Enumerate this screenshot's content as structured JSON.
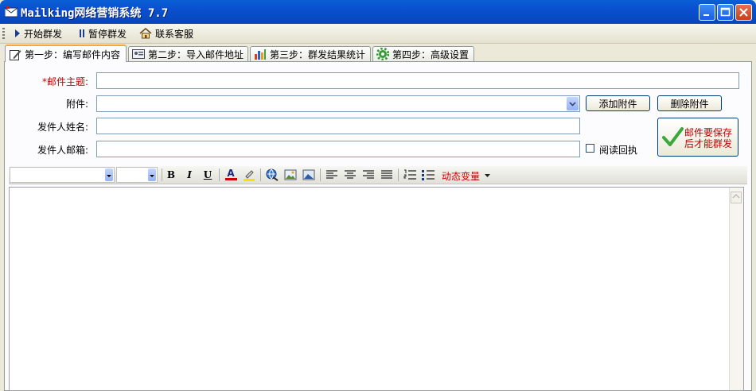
{
  "window": {
    "title": "Mailking网络营销系统 7.7"
  },
  "toolbar": {
    "start_label": "开始群发",
    "pause_label": "暂停群发",
    "contact_label": "联系客服"
  },
  "tabs": [
    {
      "label": "第一步：编写邮件内容",
      "active": true
    },
    {
      "label": "第二步：导入邮件地址",
      "active": false
    },
    {
      "label": "第三步：群发结果统计",
      "active": false
    },
    {
      "label": "第四步：高级设置",
      "active": false
    }
  ],
  "form": {
    "subject_required_mark": "*",
    "subject_label": "邮件主题:",
    "subject_value": "",
    "attachment_label": "附件:",
    "attachment_value": "",
    "sender_name_label": "发件人姓名:",
    "sender_name_value": "",
    "sender_email_label": "发件人邮箱:",
    "sender_email_value": "",
    "add_attachment_label": "添加附件",
    "remove_attachment_label": "删除附件",
    "read_receipt_label": "阅读回执",
    "read_receipt_checked": false,
    "save_notice_line1": "邮件要保存",
    "save_notice_line2": "后才能群发"
  },
  "editor_toolbar": {
    "font_family_value": "",
    "font_size_value": "",
    "bold_glyph": "B",
    "italic_glyph": "I",
    "underline_glyph": "U",
    "font_color_glyph": "A",
    "dynamic_var_label": "动态变量",
    "font_color": "#d00000",
    "highlight_color": "#f8e000"
  },
  "editor": {
    "content": ""
  },
  "colors": {
    "titlebar": "#0a5fd6",
    "required": "#c00000",
    "tab_active_accent": "#f7a836"
  }
}
